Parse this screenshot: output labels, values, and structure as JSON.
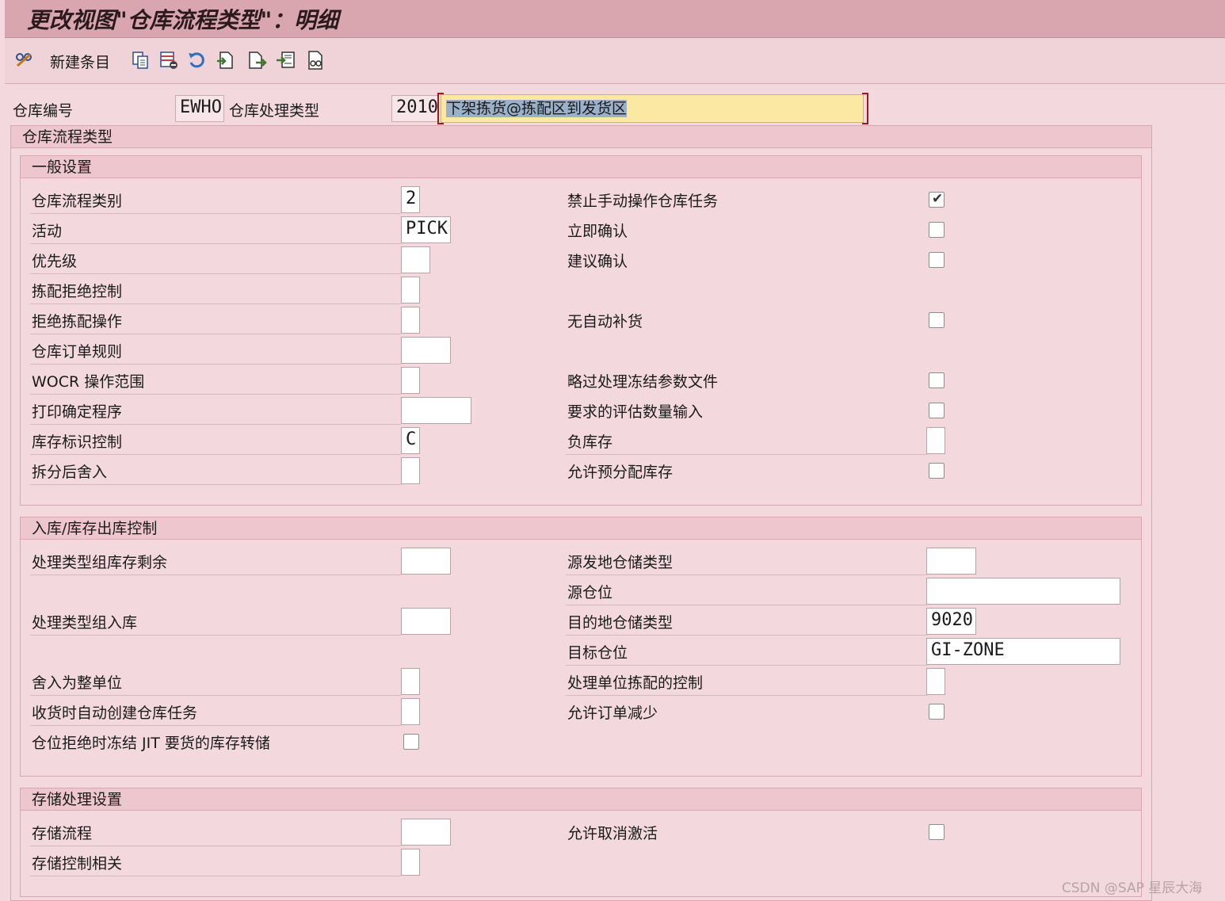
{
  "title": "更改视图\"仓库流程类型\"：明细",
  "toolbar": {
    "new_entry_label": "新建条目",
    "icons": [
      "glasses-icon",
      "copy-icon",
      "delete-icon",
      "undo-icon",
      "select-icon",
      "next-icon",
      "import-icon",
      "print-icon"
    ]
  },
  "header": {
    "warehouse_no_label": "仓库编号",
    "warehouse_no": "EWHO",
    "process_type_label": "仓库处理类型",
    "process_type": "2010",
    "process_type_desc": "下架拣货@拣配区到发货区"
  },
  "panel_title": "仓库流程类型",
  "general": {
    "title": "一般设置",
    "process_category_label": "仓库流程类别",
    "process_category": "2",
    "activity_label": "活动",
    "activity": "PICK",
    "priority_label": "优先级",
    "priority": "",
    "pick_deny_ctrl_label": "拣配拒绝控制",
    "pick_deny_ctrl": "",
    "deny_pick_op_label": "拒绝拣配操作",
    "deny_pick_op": "",
    "wo_rule_label": "仓库订单规则",
    "wo_rule": "",
    "wocr_label": "WOCR 操作范围",
    "wocr": "",
    "print_proc_label": "打印确定程序",
    "print_proc": "",
    "stock_id_ctrl_label": "库存标识控制",
    "stock_id_ctrl": "C",
    "rounding_label": "拆分后舍入",
    "rounding": "",
    "no_manual_label": "禁止手动操作仓库任务",
    "no_manual": true,
    "immediate_confirm_label": "立即确认",
    "immediate_confirm": false,
    "propose_confirm_label": "建议确认",
    "propose_confirm": false,
    "no_auto_repl_label": "无自动补货",
    "no_auto_repl": false,
    "skip_freeze_label": "略过处理冻结参数文件",
    "skip_freeze": false,
    "est_qty_label": "要求的评估数量输入",
    "est_qty": false,
    "neg_stock_label": "负库存",
    "neg_stock": "",
    "allow_prealloc_label": "允许预分配库存",
    "allow_prealloc": false
  },
  "inout": {
    "title": "入库/库存出库控制",
    "grp_stock_rem_label": "处理类型组库存剩余",
    "grp_stock_rem": "",
    "grp_putaway_label": "处理类型组入库",
    "grp_putaway": "",
    "round_whole_label": "舍入为整单位",
    "round_whole": "",
    "auto_wt_gr_label": "收货时自动创建仓库任务",
    "auto_wt_gr": "",
    "jit_label": "仓位拒绝时冻结 JIT 要货的库存转储",
    "jit": false,
    "src_type_label": "源发地仓储类型",
    "src_type": "",
    "src_bin_label": "源仓位",
    "src_bin": "",
    "dst_type_label": "目的地仓储类型",
    "dst_type": "9020",
    "dst_bin_label": "目标仓位",
    "dst_bin": "GI-ZONE",
    "hu_pick_ctrl_label": "处理单位拣配的控制",
    "hu_pick_ctrl": "",
    "allow_reduce_label": "允许订单减少",
    "allow_reduce": false
  },
  "storage": {
    "title": "存储处理设置",
    "process_label": "存储流程",
    "process": "",
    "ctrl_rel_label": "存储控制相关",
    "ctrl_rel": "",
    "allow_deact_label": "允许取消激活",
    "allow_deact": false
  },
  "watermark": "CSDN @SAP 星辰大海"
}
